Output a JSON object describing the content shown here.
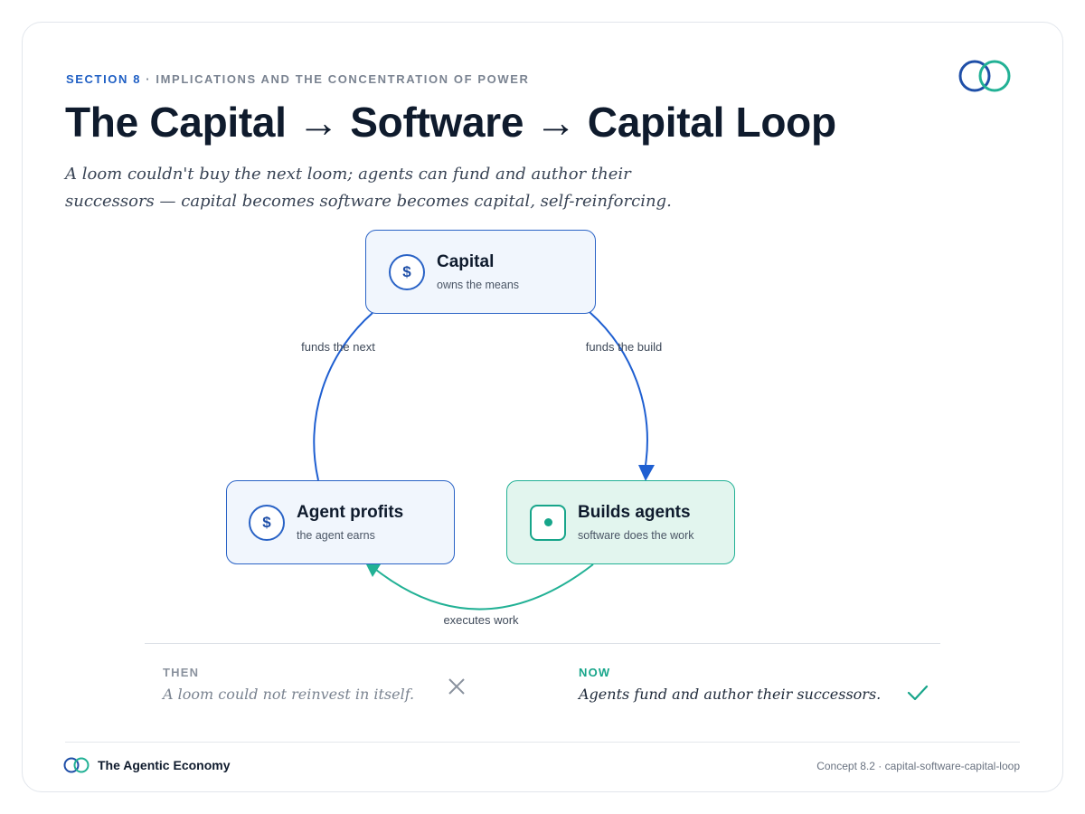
{
  "header": {
    "section": "SECTION 8",
    "separator": "·",
    "topic": "IMPLICATIONS AND THE CONCENTRATION OF POWER",
    "title": "The Capital → Software → Capital Loop",
    "subtitle_line1": "A loom couldn't buy the next loom; agents can fund and author their",
    "subtitle_line2": "successors — capital becomes software becomes capital, self-reinforcing."
  },
  "diagram": {
    "nodes": {
      "capital": {
        "icon": "dollar-icon",
        "glyph": "$",
        "title": "Capital",
        "subtitle": "owns the means"
      },
      "builds_agents": {
        "icon": "square-dot-icon",
        "title": "Builds agents",
        "subtitle": "software does the work"
      },
      "agent_profits": {
        "icon": "dollar-icon",
        "glyph": "$",
        "title": "Agent profits",
        "subtitle": "the agent earns"
      }
    },
    "edges": {
      "capital_to_builds": "funds the build",
      "builds_to_profits": "executes work",
      "profits_to_capital": "funds the next"
    },
    "colors": {
      "blue": "#1f5fd1",
      "green": "#22b195"
    }
  },
  "comparison": {
    "then": {
      "label": "THEN",
      "text": "A loom could not reinvest in itself.",
      "icon": "cross-icon"
    },
    "now": {
      "label": "NOW",
      "text": "Agents fund and author their successors.",
      "icon": "check-icon"
    }
  },
  "footer": {
    "brand": "The Agentic Economy",
    "reference": "Concept 8.2 · capital-software-capital-loop"
  }
}
